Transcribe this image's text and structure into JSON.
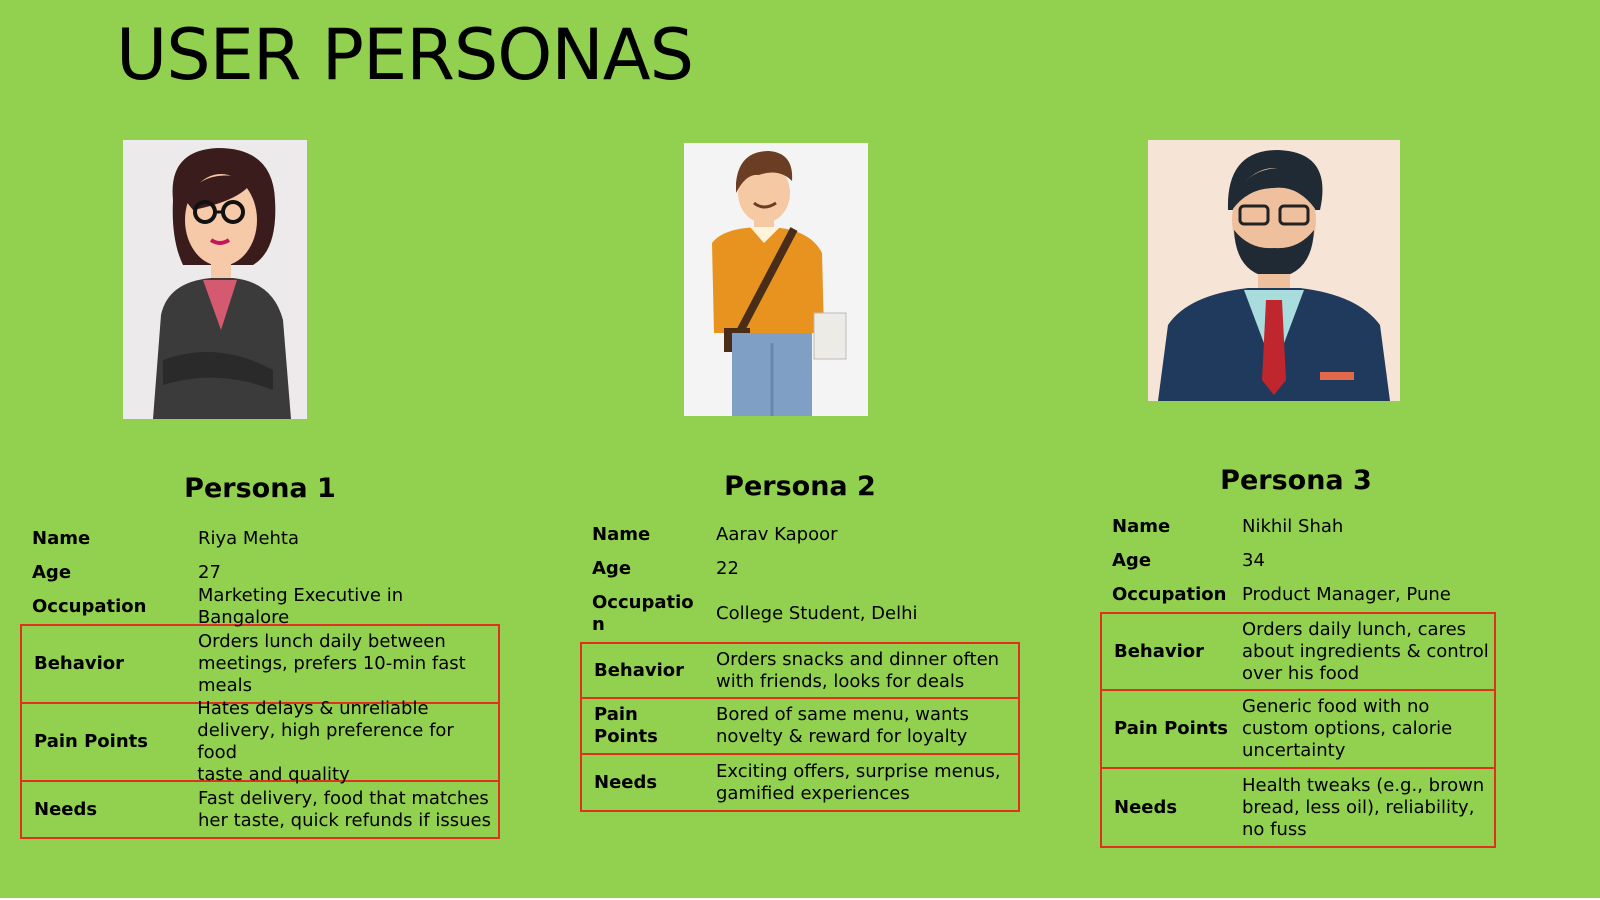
{
  "title": "USER PERSONAS",
  "colors": {
    "background": "#92d050",
    "box_border": "#e0301e"
  },
  "field_labels": {
    "name": "Name",
    "age": "Age",
    "behavior": "Behavior",
    "needs": "Needs"
  },
  "personas": [
    {
      "heading": "Persona 1",
      "occupation_label": "Occupation",
      "pain_points_label": "Pain Points",
      "name": "Riya Mehta",
      "age": "27",
      "occupation": "Marketing Executive in Bangalore",
      "behavior": [
        "Orders lunch daily between",
        "meetings, prefers 10-min fast",
        "meals"
      ],
      "pain_points": [
        "Hates delays & unreliable",
        "delivery, high preference for food",
        "taste and quality"
      ],
      "needs": [
        "Fast delivery, food that matches",
        "her taste, quick refunds if issues"
      ],
      "illustration": "woman-in-blazer-icon"
    },
    {
      "heading": "Persona 2",
      "occupation_label": [
        "Occupatio",
        "n"
      ],
      "pain_points_label": [
        "Pain",
        "Points"
      ],
      "name": "Aarav Kapoor",
      "age": "22",
      "occupation": "College Student, Delhi",
      "behavior": [
        "Orders snacks and dinner often",
        "with friends, looks for deals"
      ],
      "pain_points": [
        "Bored of same menu, wants",
        "novelty & reward for loyalty"
      ],
      "needs": [
        "Exciting offers, surprise menus,",
        "gamified experiences"
      ],
      "illustration": "student-with-bag-icon"
    },
    {
      "heading": "Persona 3",
      "occupation_label": "Occupation",
      "pain_points_label": "Pain Points",
      "name": "Nikhil Shah",
      "age": "34",
      "occupation": "Product Manager, Pune",
      "behavior": [
        "Orders daily lunch, cares",
        "about ingredients & control",
        "over his food"
      ],
      "pain_points": [
        "Generic food with no",
        "custom options, calorie",
        "uncertainty"
      ],
      "needs": [
        "Health tweaks (e.g., brown",
        "bread, less oil), reliability,",
        "no fuss"
      ],
      "illustration": "bearded-man-in-suit-icon"
    }
  ]
}
